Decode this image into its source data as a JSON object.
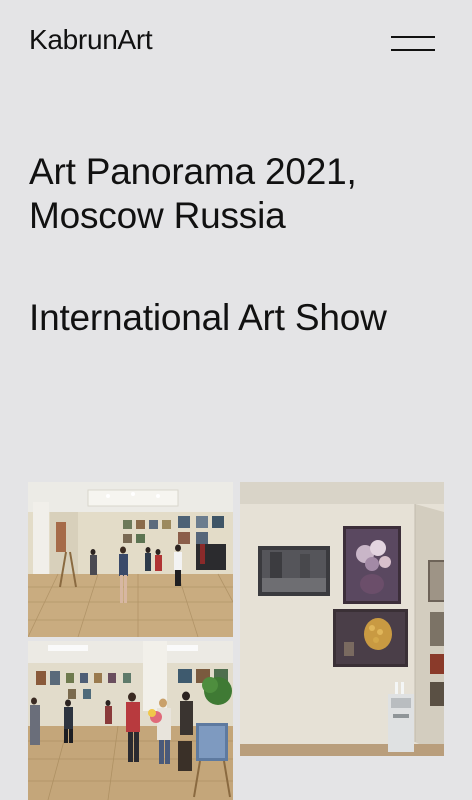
{
  "header": {
    "logo": "KabrunArt",
    "menu_icon": "hamburger-menu-icon"
  },
  "main": {
    "title": "Art Panorama 2021, Moscow Russia",
    "subtitle": "International Art Show"
  },
  "gallery": {
    "photos": [
      {
        "subject": "exhibition hall with visitors"
      },
      {
        "subject": "paintings on wall"
      },
      {
        "subject": "visitors at art show"
      }
    ]
  },
  "colors": {
    "background": "#e4e4e6",
    "text": "#111111"
  }
}
